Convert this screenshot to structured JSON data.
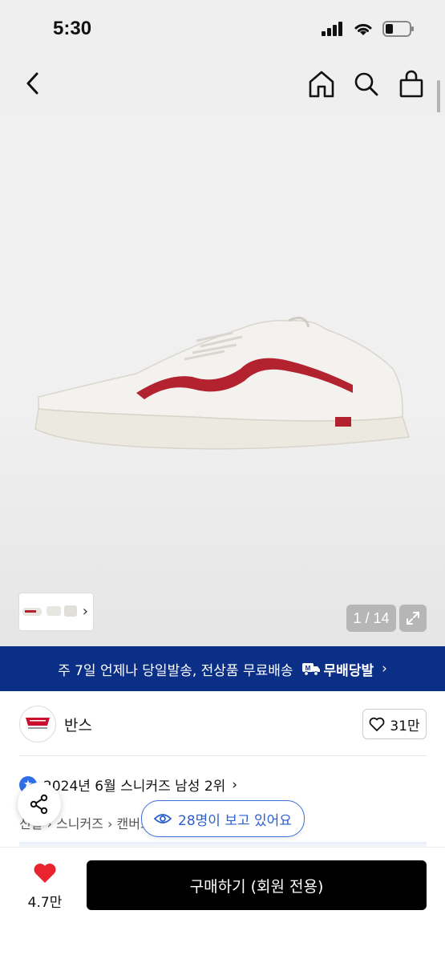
{
  "status_bar": {
    "time": "5:30"
  },
  "product": {
    "image_counter": "1 / 14"
  },
  "banner": {
    "text": "주 7일 언제나 당일발송, 전상품 무료배송",
    "badge": "무배당발",
    "chevron": "›"
  },
  "brand": {
    "name": "반스",
    "like_count": "31만"
  },
  "ranking": {
    "text": "2024년 6월 스니커즈 남성 2위",
    "chevron": "›"
  },
  "breadcrumb": {
    "items": [
      "신발",
      "스니커즈",
      "캔버스"
    ]
  },
  "viewers": {
    "text": "28명이 보고 있어요"
  },
  "bottom_bar": {
    "wish_count": "4.7만",
    "buy_label": "구매하기 (회원 전용)"
  },
  "colors": {
    "banner_bg": "#0b2f86",
    "accent_blue": "#2c5fcf",
    "heart_red": "#e8242f",
    "buy_bg": "#000000"
  }
}
